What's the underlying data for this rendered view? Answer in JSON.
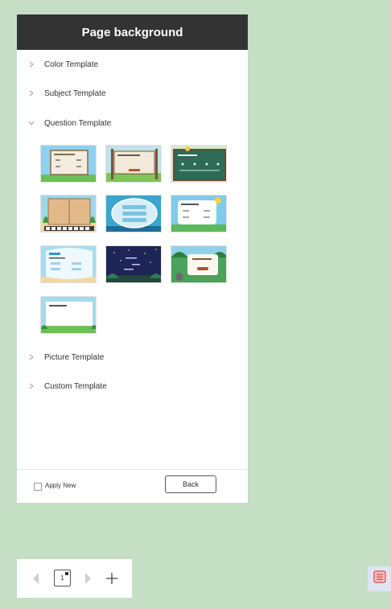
{
  "panel": {
    "title": "Page background",
    "sections": [
      {
        "label": "Color Template",
        "expanded": false
      },
      {
        "label": "Subject Template",
        "expanded": false
      },
      {
        "label": "Question Template",
        "expanded": true
      },
      {
        "label": "Picture Template",
        "expanded": false
      },
      {
        "label": "Custom Template",
        "expanded": false
      }
    ],
    "question_templates": [
      {
        "icon": "template-sky-board-thumbnail"
      },
      {
        "icon": "template-wooden-sign-thumbnail"
      },
      {
        "icon": "template-green-chalkboard-thumbnail"
      },
      {
        "icon": "template-beach-tablet-thumbnail"
      },
      {
        "icon": "template-underwater-bubble-thumbnail"
      },
      {
        "icon": "template-cloud-quiz-thumbnail"
      },
      {
        "icon": "template-sky-cards-thumbnail"
      },
      {
        "icon": "template-night-space-thumbnail"
      },
      {
        "icon": "template-forest-card-thumbnail"
      },
      {
        "icon": "template-meadow-paper-thumbnail"
      }
    ],
    "footer": {
      "apply_label": "Apply New",
      "apply_checked": false,
      "back_label": "Back"
    }
  },
  "pager": {
    "current_page": "1"
  },
  "colors": {
    "background": "#c4dfc4",
    "header": "#333333",
    "list_button_bg": "#dde6f3",
    "list_button_icon": "#e04848"
  }
}
